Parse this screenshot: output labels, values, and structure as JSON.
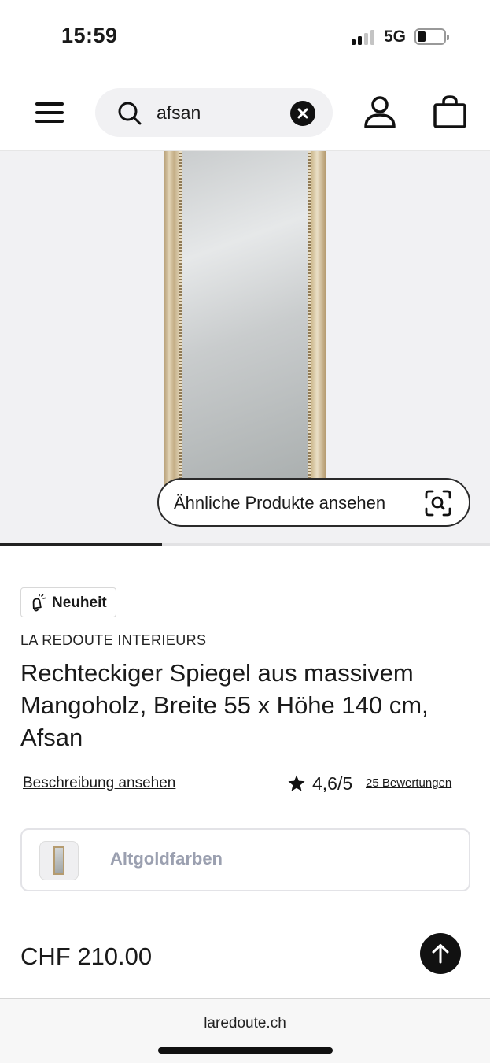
{
  "status_bar": {
    "time": "15:59",
    "network": "5G"
  },
  "header": {
    "search": {
      "value": "afsan"
    }
  },
  "gallery": {
    "similar_button_label": "Ähnliche Produkte ansehen",
    "progress_fraction": 0.33
  },
  "product": {
    "badge": "Neuheit",
    "brand": "LA REDOUTE INTERIEURS",
    "title": "Rechteckiger Spiegel aus massivem Mangoholz, Breite 55 x Höhe 140 cm, Afsan",
    "description_link": "Beschreibung ansehen",
    "rating": "4,6/5",
    "reviews_link": "25 Bewertungen",
    "variant": "Altgoldfarben",
    "price": "CHF 210.00"
  },
  "browser": {
    "url": "laredoute.ch"
  },
  "colors": {
    "accent": "#111111",
    "variant_text": "#9ba0b0",
    "image_bg": "#f1f1f3"
  },
  "icons": [
    "menu-icon",
    "search-icon",
    "clear-icon",
    "user-icon",
    "bag-icon",
    "scan-icon",
    "bell-icon",
    "star-icon",
    "arrow-up-icon"
  ]
}
